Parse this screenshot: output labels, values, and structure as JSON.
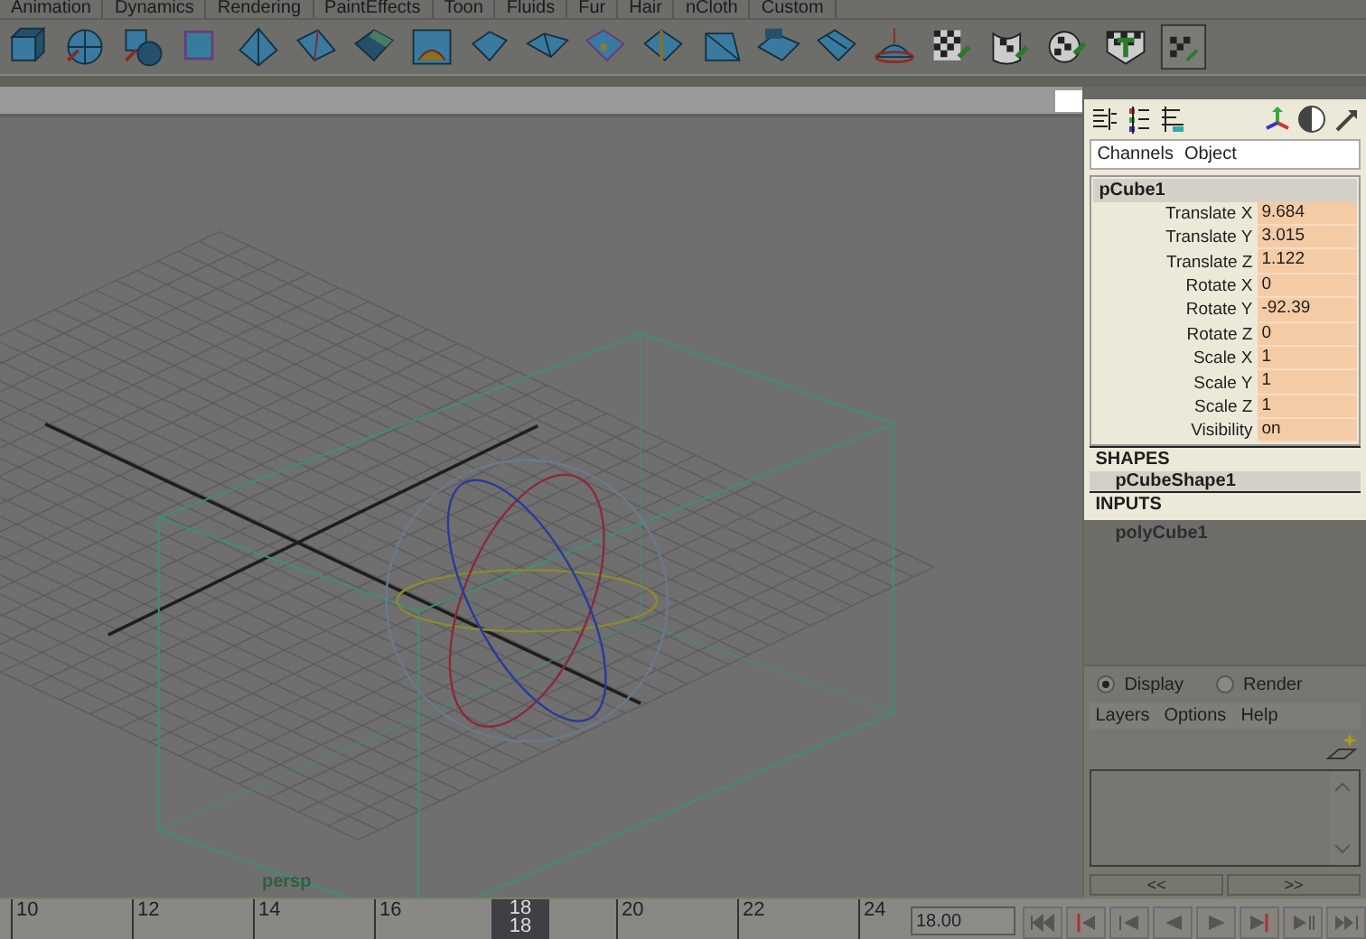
{
  "shelf": {
    "tabs": [
      {
        "label": "Animation"
      },
      {
        "label": "Dynamics"
      },
      {
        "label": "Rendering"
      },
      {
        "label": "PaintEffects"
      },
      {
        "label": "Toon"
      },
      {
        "label": "Fluids"
      },
      {
        "label": "Fur"
      },
      {
        "label": "Hair"
      },
      {
        "label": "nCloth"
      },
      {
        "label": "Custom"
      }
    ]
  },
  "viewport": {
    "camera_label": "persp"
  },
  "channel_box": {
    "menu": [
      "Channels",
      "Object"
    ],
    "object_name": "pCube1",
    "attributes": [
      {
        "name": "Translate X",
        "value": "9.684"
      },
      {
        "name": "Translate Y",
        "value": "3.015"
      },
      {
        "name": "Translate Z",
        "value": "1.122"
      },
      {
        "name": "Rotate X",
        "value": "0"
      },
      {
        "name": "Rotate Y",
        "value": "-92.39"
      },
      {
        "name": "Rotate Z",
        "value": "0"
      },
      {
        "name": "Scale X",
        "value": "1"
      },
      {
        "name": "Scale Y",
        "value": "1"
      },
      {
        "name": "Scale Z",
        "value": "1"
      },
      {
        "name": "Visibility",
        "value": "on"
      }
    ],
    "shapes_header": "SHAPES",
    "shape": "pCubeShape1",
    "inputs_header": "INPUTS",
    "input": "polyCube1"
  },
  "layer_editor": {
    "modes": [
      {
        "label": "Display",
        "selected": true
      },
      {
        "label": "Render",
        "selected": false
      }
    ],
    "menu": [
      "Layers",
      "Options",
      "Help"
    ],
    "scroll_buttons": [
      "<<",
      ">>"
    ]
  },
  "time_slider": {
    "ticks": [
      {
        "label": "10",
        "selected": false
      },
      {
        "label": "12",
        "selected": false
      },
      {
        "label": "14",
        "selected": false
      },
      {
        "label": "16",
        "selected": false
      },
      {
        "label": "18",
        "selected": true
      },
      {
        "label": "20",
        "selected": false
      },
      {
        "label": "22",
        "selected": false
      },
      {
        "label": "24",
        "selected": false
      }
    ],
    "current_frame": "18",
    "current_time": "18.00"
  }
}
